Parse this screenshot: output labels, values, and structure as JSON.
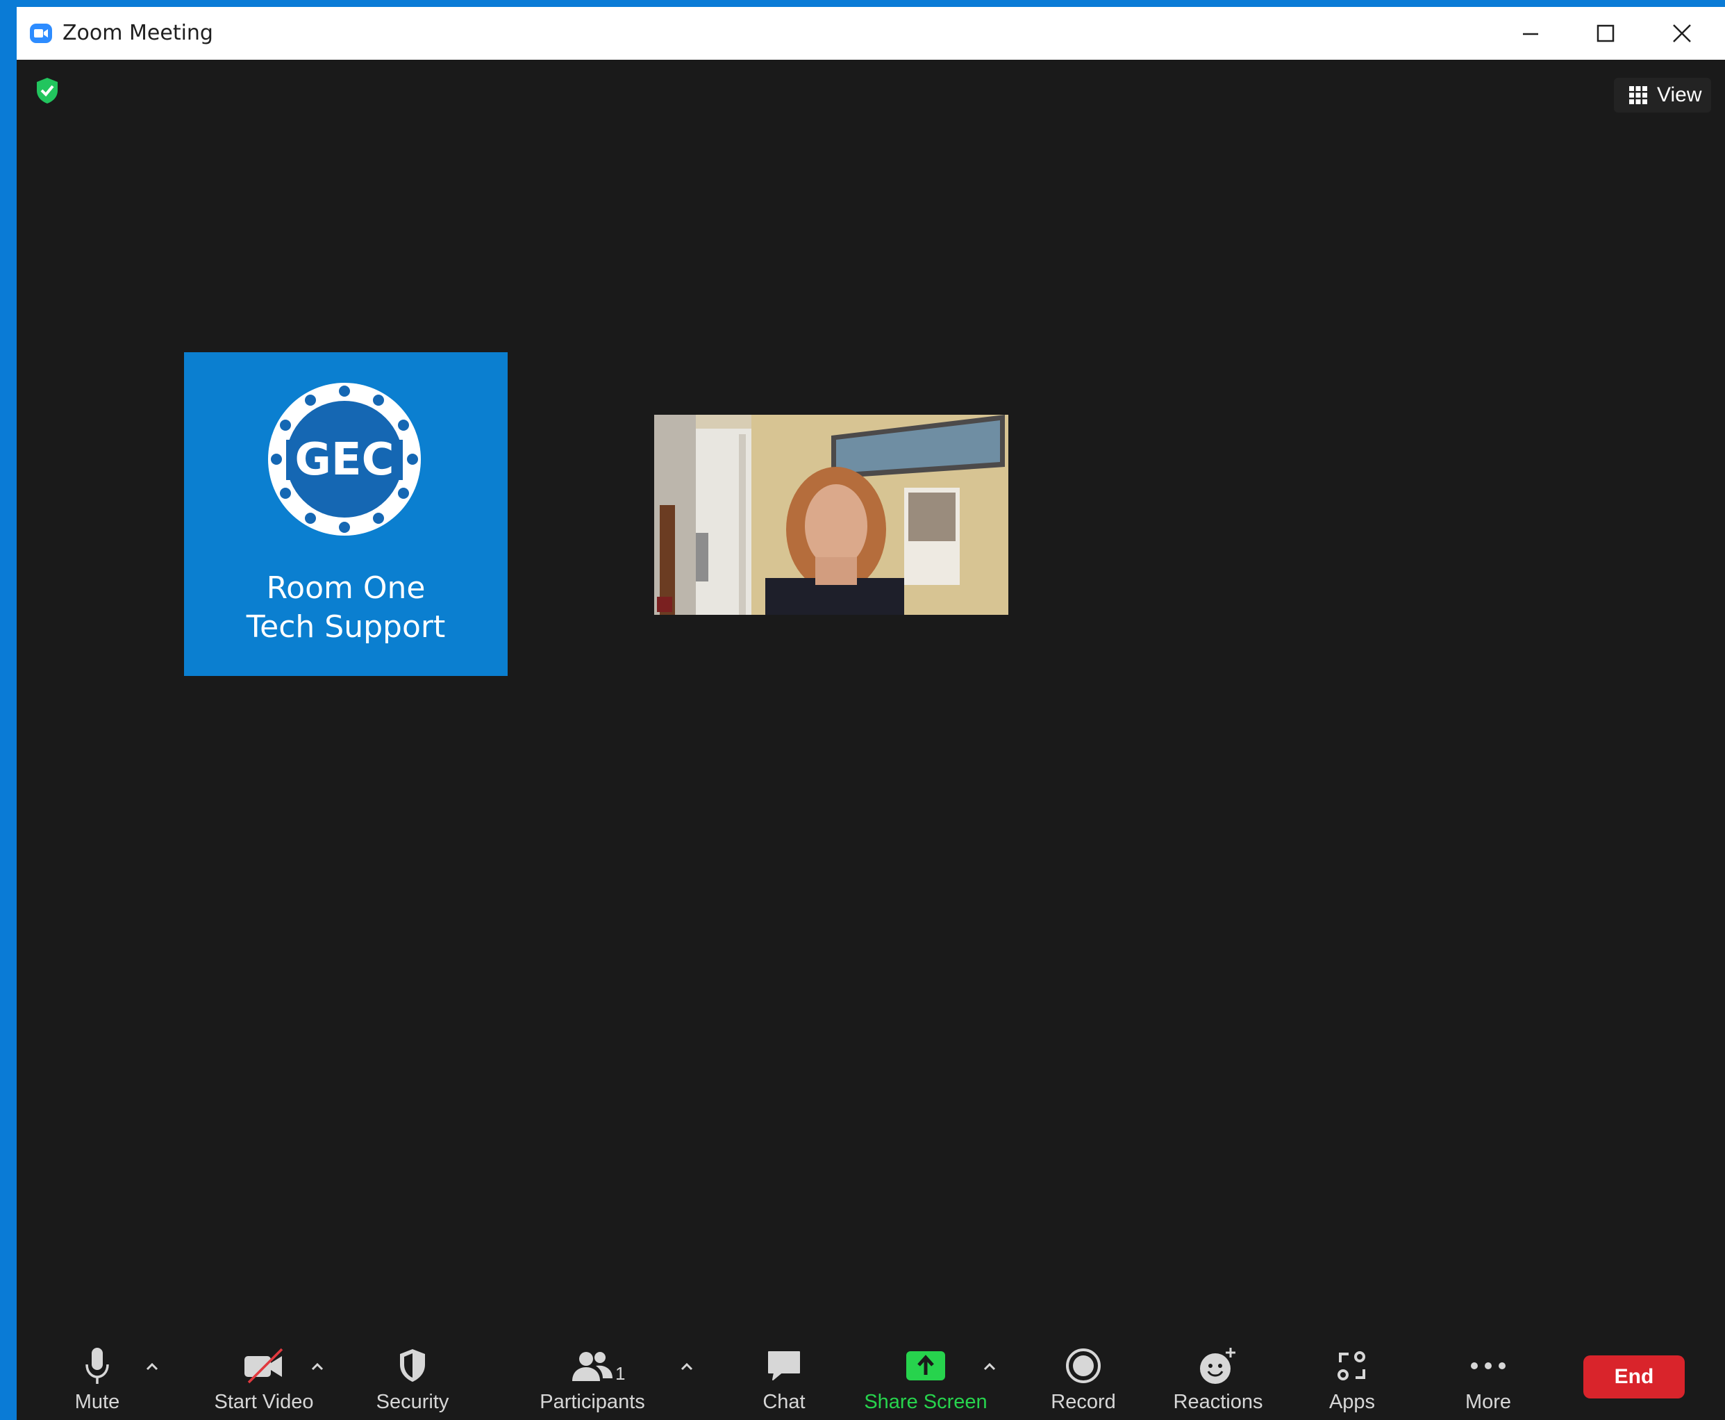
{
  "window": {
    "title": "Zoom Meeting",
    "controls": [
      "minimize",
      "maximize",
      "close"
    ]
  },
  "header": {
    "view_label": "View"
  },
  "tiles": {
    "room": {
      "logo_text": "GEC",
      "name_line1": "Room One",
      "name_line2": "Tech Support"
    }
  },
  "toolbar": {
    "mute": "Mute",
    "start_video": "Start Video",
    "security": "Security",
    "participants": "Participants",
    "participants_count": "1",
    "chat": "Chat",
    "share_screen": "Share Screen",
    "record": "Record",
    "reactions": "Reactions",
    "apps": "Apps",
    "more": "More",
    "end": "End"
  },
  "colors": {
    "accent": "#0b7fd0",
    "end": "#d9242b",
    "share": "#27d34d",
    "background": "#1a1a1a"
  }
}
